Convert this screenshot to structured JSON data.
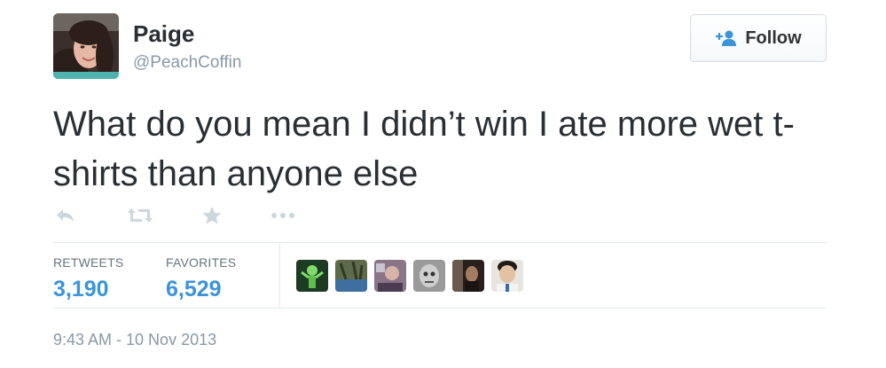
{
  "user": {
    "name": "Paige",
    "handle": "@PeachCoffin"
  },
  "follow_button": {
    "label": "Follow",
    "icon": "follow-person-icon"
  },
  "tweet": {
    "text": "What do you mean I didn’t win I ate more wet t-shirts than anyone else"
  },
  "actions": [
    {
      "icon": "reply-icon"
    },
    {
      "icon": "retweet-icon"
    },
    {
      "icon": "favorite-star-icon"
    },
    {
      "icon": "more-dots-icon"
    }
  ],
  "stats": {
    "retweets_label": "RETWEETS",
    "retweets_value": "3,190",
    "favorites_label": "FAVORITES",
    "favorites_value": "6,529"
  },
  "timestamp": "9:43 AM - 10 Nov 2013",
  "colors": {
    "accent": "#3b94d9",
    "muted": "#8899a6",
    "text": "#292f33",
    "divider": "#e1e8ed"
  }
}
